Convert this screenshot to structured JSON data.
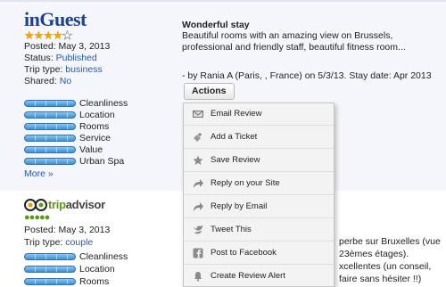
{
  "review1": {
    "logo": "inGuest",
    "rating_stars": 4,
    "max_stars": 5,
    "posted": "Posted: May 3, 2013",
    "status_label": "Status:",
    "status_value": "Published",
    "trip_label": "Trip type:",
    "trip_value": "business",
    "shared_label": "Shared:",
    "shared_value": "No",
    "criteria": [
      "Cleanliness",
      "Location",
      "Rooms",
      "Service",
      "Value",
      "Urban Spa"
    ],
    "more": "More »",
    "title": "Wonderful stay",
    "body": "Beautiful rooms with an amazing view on Brussels, professional and friendly staff, beautiful fitness room...",
    "byline": "- by Rania A (Paris, , France) on 5/3/13. Stay date: Apr 2013",
    "actions_label": "Actions"
  },
  "menu": {
    "items": [
      {
        "label": "Email Review",
        "icon": "envelope-icon"
      },
      {
        "label": "Add a Ticket",
        "icon": "ticket-icon"
      },
      {
        "label": "Save Review",
        "icon": "star-icon"
      },
      {
        "label": "Reply on your Site",
        "icon": "reply-arrow-icon"
      },
      {
        "label": "Reply by Email",
        "icon": "reply-arrow-icon"
      },
      {
        "label": "Tweet This",
        "icon": "twitter-bird-icon"
      },
      {
        "label": "Post to Facebook",
        "icon": "facebook-icon"
      },
      {
        "label": "Create Review Alert",
        "icon": "bell-icon"
      }
    ]
  },
  "review2": {
    "logo_prefix": "trip",
    "logo_suffix": "advisor",
    "rating_dots": 5,
    "posted": "Posted: May 3, 2013",
    "trip_label": "Trip type:",
    "trip_value": "couple",
    "criteria": [
      "Cleanliness",
      "Location",
      "Rooms"
    ],
    "text_lines": [
      "perbe sur Bruxelles (vue",
      "23èmes étages).",
      "xcellentes (un conseil,",
      "faire sans hésiter !!)"
    ]
  },
  "colors": {
    "link": "#2858b8",
    "logo_blue": "#1f3f91",
    "star": "#f0a800",
    "tripadvisor_green": "#5a9a1a",
    "bar_blue": "#3f8fd4"
  }
}
